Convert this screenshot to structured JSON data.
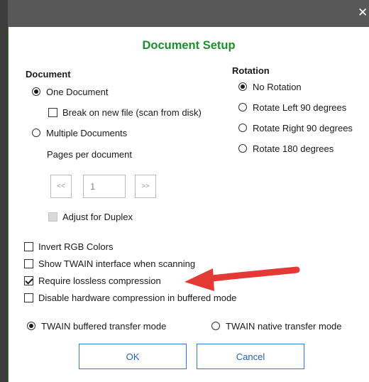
{
  "window": {
    "close_glyph": "✕"
  },
  "dialog": {
    "title": "Document Setup"
  },
  "document": {
    "heading": "Document",
    "one_document": "One Document",
    "break_on_new_file": "Break on new file (scan from disk)",
    "multiple_documents": "Multiple Documents",
    "pages_per_document_label": "Pages per document",
    "prev_glyph": "<<",
    "pages_value": "1",
    "next_glyph": ">>",
    "adjust_for_duplex": "Adjust for Duplex"
  },
  "rotation": {
    "heading": "Rotation",
    "options": [
      "No Rotation",
      "Rotate Left 90 degrees",
      "Rotate Right 90 degrees",
      "Rotate 180 degrees"
    ],
    "selected": "No Rotation"
  },
  "options": {
    "invert_rgb": "Invert RGB Colors",
    "show_twain_ui": "Show TWAIN interface when scanning",
    "require_lossless": "Require lossless compression",
    "disable_hw_compression": "Disable hardware compression in buffered mode"
  },
  "transfer": {
    "buffered": "TWAIN buffered transfer mode",
    "native": "TWAIN native transfer mode",
    "selected": "TWAIN buffered transfer mode"
  },
  "buttons": {
    "ok": "OK",
    "cancel": "Cancel"
  },
  "colors": {
    "title_green": "#1a8f2c",
    "annotation_arrow": "#e53935",
    "button_border": "#2b7bd4"
  }
}
